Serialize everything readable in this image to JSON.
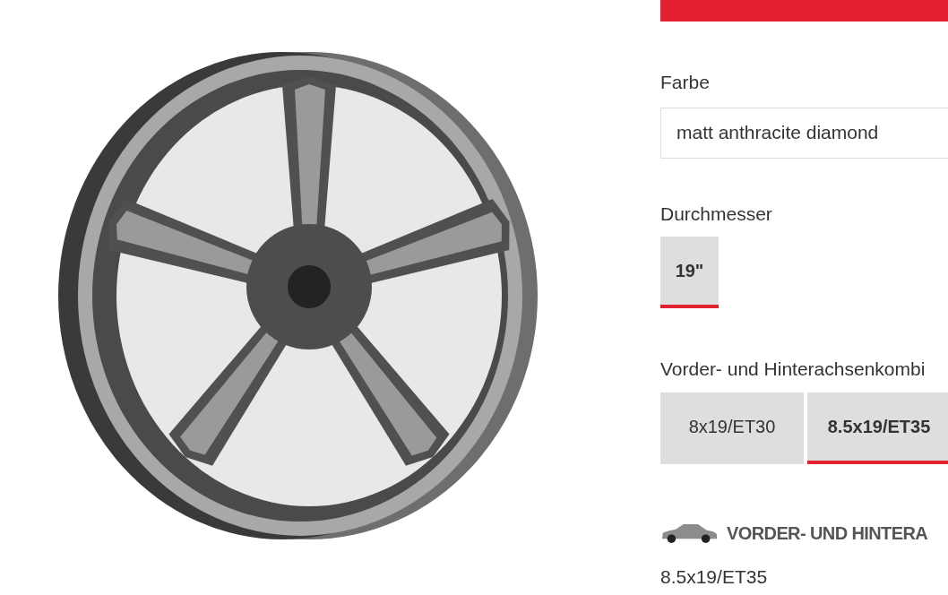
{
  "color": {
    "label": "Farbe",
    "value": "matt anthracite diamond"
  },
  "diameter": {
    "label": "Durchmesser",
    "options": [
      {
        "label": "19\"",
        "selected": true
      }
    ]
  },
  "combination": {
    "label": "Vorder- und Hinterachsenkombi",
    "options": [
      {
        "label": "8x19/ET30",
        "selected": false
      },
      {
        "label": "8.5x19/ET35",
        "selected": true
      }
    ]
  },
  "summary": {
    "heading": "VORDER- UND HINTERA",
    "value": "8.5x19/ET35"
  }
}
